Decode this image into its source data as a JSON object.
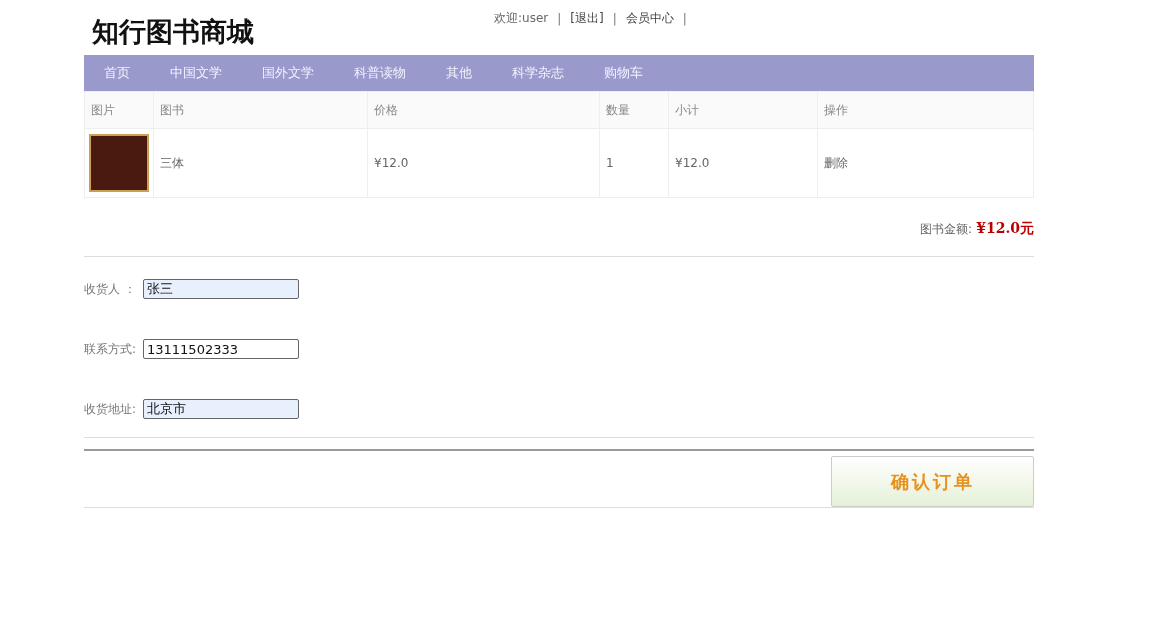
{
  "site_title": "知行图书商城",
  "top_links": [
    {
      "text": "欢迎:user",
      "kind": "text"
    },
    {
      "text": "|",
      "kind": "separator"
    },
    {
      "text": "[退出]",
      "kind": "link"
    },
    {
      "text": "|",
      "kind": "separator"
    },
    {
      "text": "会员中心",
      "kind": "link"
    },
    {
      "text": "|",
      "kind": "separator"
    }
  ],
  "nav": [
    "首页",
    "中国文学",
    "国外文学",
    "科普读物",
    "其他",
    "科学杂志",
    "购物车"
  ],
  "table": {
    "columns": [
      "图片",
      "图书",
      "价格",
      "数量",
      "小计",
      "操作"
    ],
    "rows": [
      {
        "book": "三体",
        "price": "¥12.0",
        "quantity": "1",
        "subtotal": "¥12.0",
        "action": "删除"
      }
    ]
  },
  "total": {
    "label": "图书金额:",
    "value": "¥12.0元"
  },
  "form": [
    {
      "label": "收货人 ：",
      "value": "张三",
      "autofilled": true
    },
    {
      "label": "联系方式:",
      "value": "13111502333",
      "autofilled": false
    },
    {
      "label": "收货地址:",
      "value": "北京市",
      "autofilled": true
    }
  ],
  "submit": "确认订单"
}
